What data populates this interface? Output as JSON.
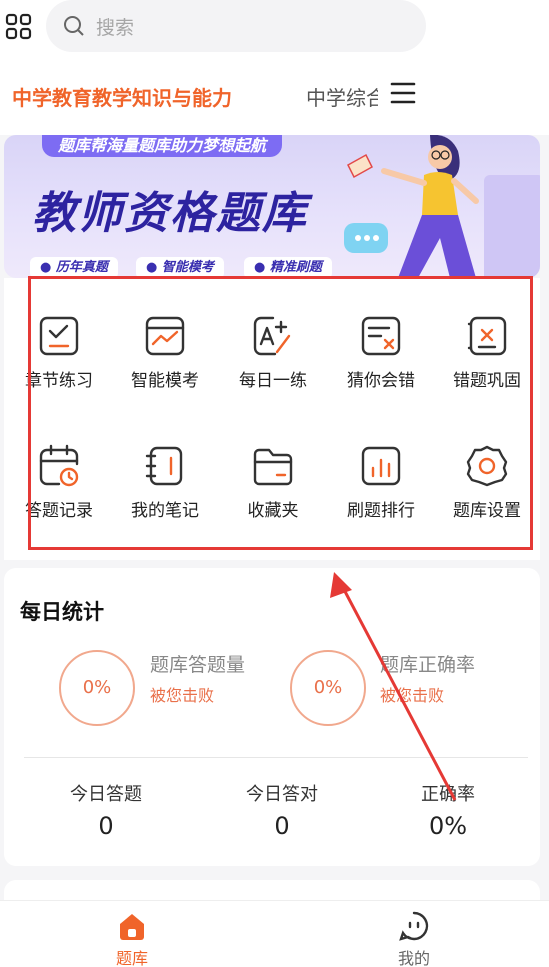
{
  "header": {
    "grid_icon": "grid-apps-icon",
    "search": {
      "placeholder": "搜索",
      "icon": "search-icon"
    },
    "subject_title": "中学教育教学知识与能力",
    "level_selector": "中学综合",
    "menu_icon": "hamburger-menu-icon"
  },
  "banner": {
    "slogan": "题库帮海量题库助力梦想起航",
    "headline": "教师资格题库",
    "tags": [
      "● 历年真题",
      "● 智能模考",
      "● 精准刷题"
    ],
    "accent": "#2d23a0"
  },
  "features": [
    {
      "label": "章节练习",
      "icon": "chapter-check-icon"
    },
    {
      "label": "智能模考",
      "icon": "trend-chart-icon"
    },
    {
      "label": "每日一练",
      "icon": "grade-pencil-icon"
    },
    {
      "label": "猜你会错",
      "icon": "error-doc-icon"
    },
    {
      "label": "错题巩固",
      "icon": "error-book-icon"
    },
    {
      "label": "答题记录",
      "icon": "calendar-clock-icon"
    },
    {
      "label": "我的笔记",
      "icon": "notebook-icon"
    },
    {
      "label": "收藏夹",
      "icon": "folder-icon"
    },
    {
      "label": "刷题排行",
      "icon": "bar-chart-icon"
    },
    {
      "label": "题库设置",
      "icon": "gear-icon"
    }
  ],
  "daily_stats": {
    "title": "每日统计",
    "bank_answers": {
      "percent": "0%",
      "label": "题库答题量",
      "sub": "被您击败"
    },
    "bank_accuracy": {
      "percent": "0%",
      "label": "题库正确率",
      "sub": "被您击败"
    },
    "summary": [
      {
        "label": "今日答题",
        "value": "0"
      },
      {
        "label": "今日答对",
        "value": "0"
      },
      {
        "label": "正确率",
        "value": "0%"
      }
    ]
  },
  "tabbar": {
    "items": [
      {
        "label": "题库",
        "icon": "home-icon",
        "active": true
      },
      {
        "label": "我的",
        "icon": "profile-chat-icon",
        "active": false
      }
    ]
  },
  "colors": {
    "brand_orange": "#f0642a",
    "highlight_red": "#e53935",
    "icon_stroke": "#333333",
    "icon_accent": "#f0642a"
  }
}
